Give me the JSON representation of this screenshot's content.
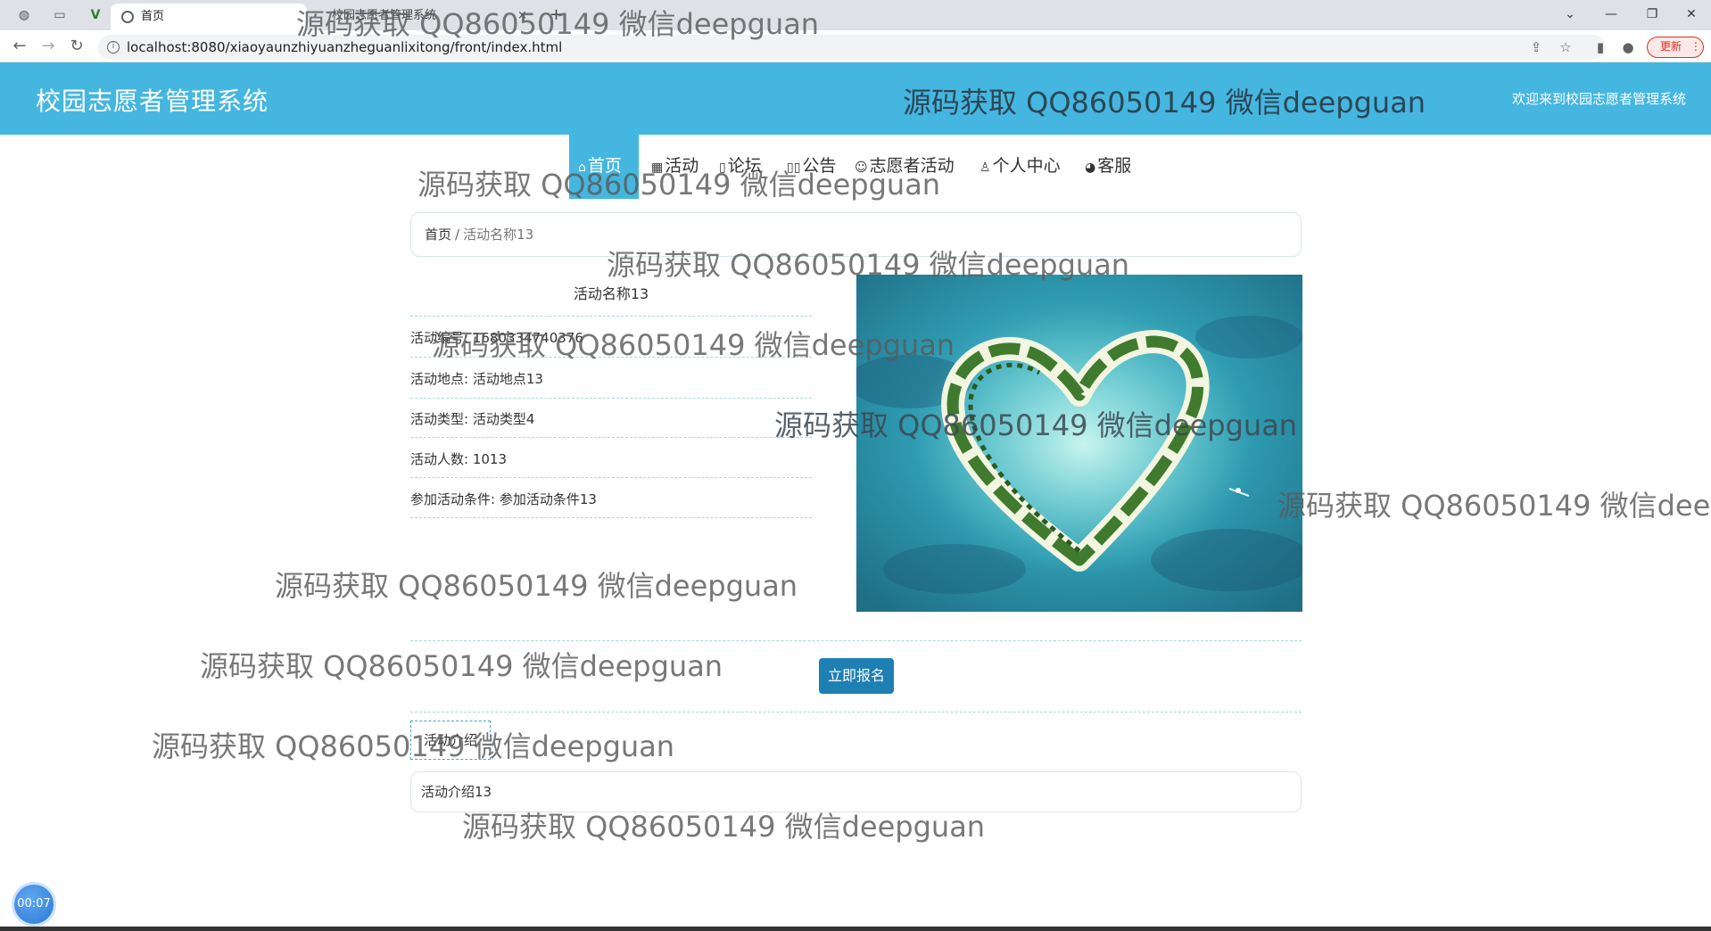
{
  "browser": {
    "active_tab_title": "首页",
    "second_tab_title": "校园志愿者管理系统",
    "url": "localhost:8080/xiaoyaunzhiyuanzheguanlixitong/front/index.html",
    "update_label": "更新"
  },
  "site": {
    "title": "校园志愿者管理系统",
    "welcome": "欢迎来到校园志愿者管理系统",
    "accent_color": "#45b6e0"
  },
  "nav": {
    "items": [
      {
        "label": "首页",
        "icon": "home-icon",
        "active": true
      },
      {
        "label": "活动",
        "icon": "calendar-icon"
      },
      {
        "label": "论坛",
        "icon": "forum-icon"
      },
      {
        "label": "公告",
        "icon": "notice-icon"
      },
      {
        "label": "志愿者活动",
        "icon": "volunteer-icon"
      },
      {
        "label": "个人中心",
        "icon": "user-icon"
      },
      {
        "label": "客服",
        "icon": "support-icon"
      }
    ]
  },
  "breadcrumb": {
    "home": "首页",
    "separator": "/",
    "current": "活动名称13"
  },
  "detail": {
    "title": "活动名称13",
    "fields": [
      {
        "label": "活动编号",
        "value": "1680334740376"
      },
      {
        "label": "活动地点",
        "value": "活动地点13"
      },
      {
        "label": "活动类型",
        "value": "活动类型4"
      },
      {
        "label": "活动人数",
        "value": "1013"
      },
      {
        "label": "参加活动条件",
        "value": "参加活动条件13"
      }
    ],
    "field_texts": [
      "活动编号: 1680334740376",
      "活动地点: 活动地点13",
      "活动类型: 活动类型4",
      "活动人数: 1013",
      "参加活动条件: 参加活动条件13"
    ],
    "image_alt": "heart-shaped island"
  },
  "actions": {
    "signup_label": "立即报名"
  },
  "intro": {
    "tab_label": "活动介绍",
    "content": "活动介绍13"
  },
  "recorder": {
    "timer": "00:07"
  },
  "watermark": {
    "text": "源码获取 QQ86050149 微信deepguan"
  }
}
